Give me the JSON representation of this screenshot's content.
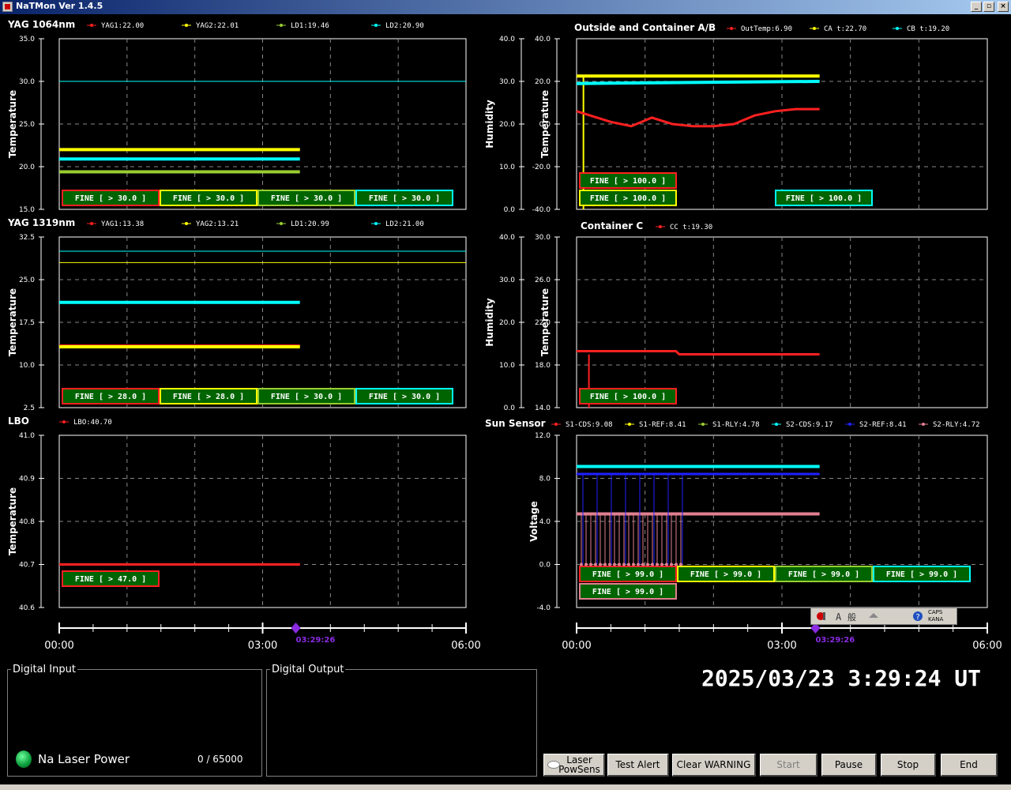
{
  "window": {
    "title": "NaTMon Ver 1.4.5"
  },
  "panels": [
    {
      "id": "yag1064",
      "label": "YAG 1064nm",
      "ylabel": "Temperature",
      "y2label": "",
      "ylim": [
        15.0,
        35.0
      ],
      "yticks": [
        "35.0",
        "30.0",
        "25.0",
        "20.0",
        "15.0"
      ],
      "y2ticks": [],
      "legend": [
        {
          "text": "YAG1:22.00",
          "color": "#ff2020"
        },
        {
          "text": "YAG2:22.01",
          "color": "#ffff00"
        },
        {
          "text": "LD1:19.46",
          "color": "#9acd32"
        },
        {
          "text": "LD2:20.90",
          "color": "#00ffff"
        }
      ],
      "series": [
        {
          "color": "#ff2020",
          "width": 3,
          "points": [
            [
              0,
              22.0
            ],
            [
              3.55,
              22.0
            ]
          ]
        },
        {
          "color": "#ffff00",
          "width": 4,
          "points": [
            [
              0,
              22.0
            ],
            [
              3.55,
              22.0
            ]
          ]
        },
        {
          "color": "#00ffff",
          "width": 4,
          "points": [
            [
              0,
              20.9
            ],
            [
              3.55,
              20.9
            ]
          ]
        },
        {
          "color": "#9acd32",
          "width": 4,
          "points": [
            [
              0,
              19.4
            ],
            [
              3.55,
              19.4
            ]
          ]
        }
      ],
      "thresholds": [
        {
          "color": "#00ffff",
          "value": 30.0
        }
      ],
      "fine": [
        {
          "text": "FINE [ > 30.0 ]",
          "border": "#ff2020"
        },
        {
          "text": "FINE [ > 30.0 ]",
          "border": "#ffff00"
        },
        {
          "text": "FINE [ > 30.0 ]",
          "border": "#9acd32"
        },
        {
          "text": "FINE [ > 30.0 ]",
          "border": "#00ffff"
        }
      ]
    },
    {
      "id": "outside",
      "label": "Outside and Container A/B",
      "ylabel": "Temperature",
      "y2label": "Humidity",
      "ylim": [
        -40.0,
        40.0
      ],
      "yticks": [
        "40.0",
        "20.0",
        "0.0",
        "-20.0",
        "-40.0"
      ],
      "y2ticks": [
        "40.0",
        "30.0",
        "20.0",
        "10.0",
        "0.0"
      ],
      "legend": [
        {
          "text": "OutTemp:6.90",
          "color": "#ff2020"
        },
        {
          "text": "CA t:22.70",
          "color": "#ffff00"
        },
        {
          "text": "CB t:19.20",
          "color": "#00ffff"
        }
      ],
      "series": [
        {
          "color": "#ffff00",
          "width": 4,
          "points": [
            [
              0,
              22.5
            ],
            [
              3.55,
              22.5
            ]
          ]
        },
        {
          "color": "#ffff00",
          "width": 2,
          "points": [
            [
              0.1,
              22.5
            ],
            [
              0.1,
              -40
            ]
          ]
        },
        {
          "color": "#00ffff",
          "width": 4,
          "points": [
            [
              0,
              19.0
            ],
            [
              3.55,
              20.0
            ]
          ]
        },
        {
          "color": "#ff2020",
          "width": 3,
          "points": [
            [
              0,
              6
            ],
            [
              0.3,
              3
            ],
            [
              0.5,
              1
            ],
            [
              0.8,
              -1
            ],
            [
              1.1,
              3
            ],
            [
              1.4,
              0
            ],
            [
              1.7,
              -1
            ],
            [
              2.0,
              -1
            ],
            [
              2.3,
              0
            ],
            [
              2.6,
              4
            ],
            [
              2.9,
              6
            ],
            [
              3.2,
              7
            ],
            [
              3.55,
              7
            ]
          ]
        }
      ],
      "thresholds": [],
      "fine": [
        {
          "text": "FINE [ > 100.0 ]",
          "border": "#ff2020",
          "slot": 0,
          "row": 0
        },
        {
          "text": "FINE [ > 100.0 ]",
          "border": "#ffff00",
          "slot": 0,
          "row": 1
        },
        {
          "text": "FINE [ > 100.0 ]",
          "border": "#00ffff",
          "slot": 2,
          "row": 1
        }
      ]
    },
    {
      "id": "yag1319",
      "label": "YAG 1319nm",
      "ylabel": "Temperature",
      "y2label": "",
      "ylim": [
        2.5,
        32.5
      ],
      "yticks": [
        "32.5",
        "25.0",
        "17.5",
        "10.0",
        "2.5"
      ],
      "y2ticks": [],
      "legend": [
        {
          "text": "YAG1:13.38",
          "color": "#ff2020"
        },
        {
          "text": "YAG2:13.21",
          "color": "#ffff00"
        },
        {
          "text": "LD1:20.99",
          "color": "#9acd32"
        },
        {
          "text": "LD2:21.00",
          "color": "#00ffff"
        }
      ],
      "series": [
        {
          "color": "#00ffff",
          "width": 4,
          "points": [
            [
              0,
              21.0
            ],
            [
              3.55,
              21.0
            ]
          ]
        },
        {
          "color": "#ff2020",
          "width": 3,
          "points": [
            [
              0,
              13.4
            ],
            [
              3.55,
              13.4
            ]
          ]
        },
        {
          "color": "#ffff00",
          "width": 4,
          "points": [
            [
              0,
              13.2
            ],
            [
              3.55,
              13.2
            ]
          ]
        }
      ],
      "thresholds": [
        {
          "color": "#00ffff",
          "value": 30.0
        },
        {
          "color": "#ffff00",
          "value": 28.0
        }
      ],
      "fine": [
        {
          "text": "FINE [ > 28.0 ]",
          "border": "#ff2020"
        },
        {
          "text": "FINE [ > 28.0 ]",
          "border": "#ffff00"
        },
        {
          "text": "FINE [ > 30.0 ]",
          "border": "#9acd32"
        },
        {
          "text": "FINE [ > 30.0 ]",
          "border": "#00ffff"
        }
      ]
    },
    {
      "id": "containerc",
      "label": "Container C",
      "ylabel": "Temperature",
      "y2label": "Humidity",
      "ylim": [
        14.0,
        30.0
      ],
      "yticks": [
        "30.0",
        "26.0",
        "22.0",
        "18.0",
        "14.0"
      ],
      "y2ticks": [
        "40.0",
        "30.0",
        "20.0",
        "10.0",
        "0.0"
      ],
      "legend": [
        {
          "text": "CC t:19.30",
          "color": "#ff2020"
        }
      ],
      "series": [
        {
          "color": "#ff2020",
          "width": 3,
          "points": [
            [
              0,
              19.3
            ],
            [
              1.45,
              19.3
            ],
            [
              1.5,
              19.0
            ],
            [
              3.55,
              19.0
            ]
          ]
        },
        {
          "color": "#ff2020",
          "width": 2,
          "points": [
            [
              0.18,
              19.0
            ],
            [
              0.18,
              14.0
            ]
          ]
        }
      ],
      "thresholds": [],
      "fine": [
        {
          "text": "FINE [ > 100.0 ]",
          "border": "#ff2020",
          "slot": 0,
          "row": 1
        }
      ]
    },
    {
      "id": "lbo",
      "label": "LBO",
      "ylabel": "Temperature",
      "y2label": "",
      "ylim": [
        40.6,
        41.0
      ],
      "yticks": [
        "41.0",
        "40.9",
        "40.8",
        "40.7",
        "40.6"
      ],
      "y2ticks": [],
      "legend": [
        {
          "text": "LBO:40.70",
          "color": "#ff2020"
        }
      ],
      "series": [
        {
          "color": "#ff2020",
          "width": 3,
          "points": [
            [
              0,
              40.7
            ],
            [
              3.55,
              40.7
            ]
          ]
        }
      ],
      "thresholds": [],
      "fine": [
        {
          "text": "FINE [ > 47.0 ]",
          "border": "#ff2020",
          "slot": 0,
          "row": 0
        }
      ]
    },
    {
      "id": "sun",
      "label": "Sun Sensor",
      "ylabel": "Voltage",
      "y2label": "",
      "ylim": [
        -4.0,
        12.0
      ],
      "yticks": [
        "12.0",
        "8.0",
        "4.0",
        "0.0",
        "-4.0"
      ],
      "y2ticks": [],
      "legend": [
        {
          "text": "S1-CDS:9.08",
          "color": "#ff2020"
        },
        {
          "text": "S1-REF:8.41",
          "color": "#ffff00"
        },
        {
          "text": "S1-RLY:4.78",
          "color": "#9acd32"
        },
        {
          "text": "S2-CDS:9.17",
          "color": "#00ffff"
        },
        {
          "text": "S2-REF:8.41",
          "color": "#2020ff"
        },
        {
          "text": "S2-RLY:4.72",
          "color": "#e08090"
        }
      ],
      "series": [
        {
          "color": "#00ffff",
          "width": 4,
          "points": [
            [
              0,
              9.1
            ],
            [
              3.55,
              9.1
            ]
          ]
        },
        {
          "color": "#2020ff",
          "width": 3,
          "points": [
            [
              0,
              8.4
            ],
            [
              3.55,
              8.4
            ]
          ]
        },
        {
          "color": "#e08090",
          "width": 4,
          "points": [
            [
              0,
              4.7
            ],
            [
              3.55,
              4.7
            ]
          ]
        }
      ],
      "thresholds": [],
      "fine": [
        {
          "text": "FINE [ > 99.0 ]",
          "border": "#ff2020",
          "slot": 0,
          "row": 0
        },
        {
          "text": "FINE [ > 99.0 ]",
          "border": "#ffff00",
          "slot": 1,
          "row": 0
        },
        {
          "text": "FINE [ > 99.0 ]",
          "border": "#9acd32",
          "slot": 2,
          "row": 0
        },
        {
          "text": "FINE [ > 99.0 ]",
          "border": "#00ffff",
          "slot": 3,
          "row": 0
        },
        {
          "text": "FINE [ > 99.0 ]",
          "border": "#e08090",
          "slot": 0,
          "row": 1
        }
      ]
    }
  ],
  "time_axis": {
    "labels": [
      "00:00",
      "03:00",
      "06:00"
    ],
    "marker_label": "03:29:26",
    "marker_value": 3.49,
    "xlim": [
      0,
      6
    ]
  },
  "digital_input": {
    "title": "Digital Input",
    "led_label": "Na Laser Power",
    "counter": "0 /  65000"
  },
  "digital_output": {
    "title": "Digital Output"
  },
  "clock": "2025/03/23  3:29:24 UT",
  "buttons": {
    "laser_powsens": "Laser PowSens",
    "test_alert": "Test Alert",
    "clear_warning": "Clear WARNING",
    "start": "Start",
    "pause": "Pause",
    "stop": "Stop",
    "end": "End"
  },
  "ime": {
    "caps": "CAPS",
    "kana": "KANA"
  }
}
